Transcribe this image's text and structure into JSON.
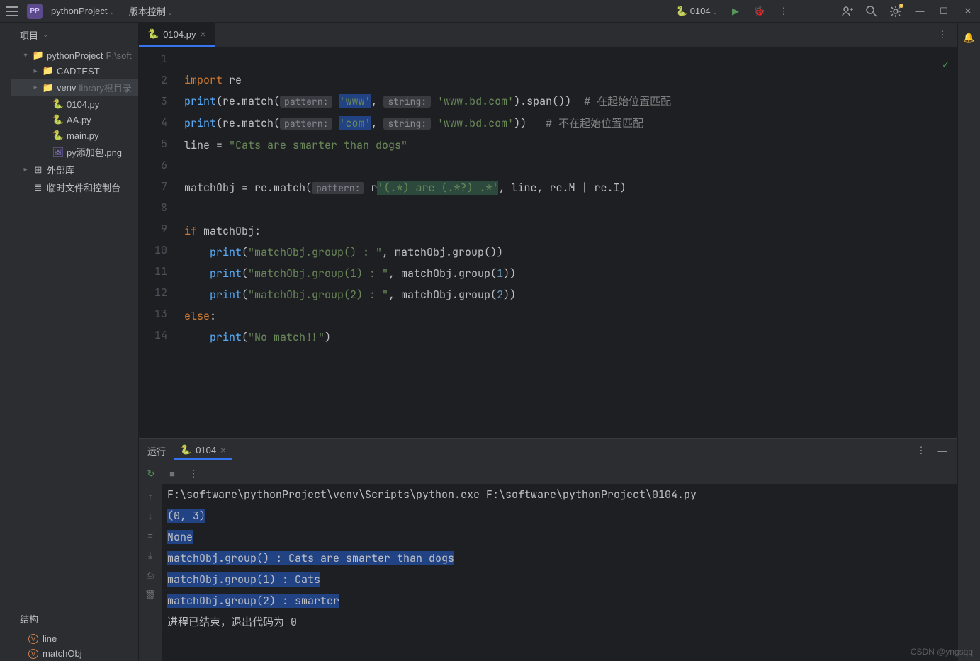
{
  "titlebar": {
    "project_badge": "PP",
    "project_name": "pythonProject",
    "vcs_label": "版本控制",
    "run_config": "0104",
    "icons": {
      "add_user": "👤₊",
      "search": "🔍",
      "settings": "⚙",
      "minimize": "—",
      "maximize": "☐",
      "close": "✕"
    }
  },
  "sidebar": {
    "header": "项目",
    "root": {
      "name": "pythonProject",
      "hint": "F:\\soft"
    },
    "items": [
      {
        "indent": 1,
        "arrow": "▾",
        "icon": "folder",
        "label": "pythonProject",
        "hint": "F:\\soft"
      },
      {
        "indent": 2,
        "arrow": "▸",
        "icon": "folder",
        "label": "CADTEST"
      },
      {
        "indent": 2,
        "arrow": "▸",
        "icon": "folder",
        "label": "venv",
        "hint": "library根目录",
        "sel": true
      },
      {
        "indent": 3,
        "arrow": "",
        "icon": "py",
        "label": "0104.py"
      },
      {
        "indent": 3,
        "arrow": "",
        "icon": "py",
        "label": "AA.py"
      },
      {
        "indent": 3,
        "arrow": "",
        "icon": "py",
        "label": "main.py"
      },
      {
        "indent": 3,
        "arrow": "",
        "icon": "img",
        "label": "py添加包.png"
      },
      {
        "indent": 1,
        "arrow": "▸",
        "icon": "lib",
        "label": "外部库"
      },
      {
        "indent": 1,
        "arrow": "",
        "icon": "scratch",
        "label": "临时文件和控制台"
      }
    ],
    "structure_header": "结构",
    "structure": [
      {
        "badge": "V",
        "label": "line"
      },
      {
        "badge": "V",
        "label": "matchObj"
      }
    ]
  },
  "editor": {
    "tab_name": "0104.py",
    "lines": [
      "1",
      "2",
      "3",
      "4",
      "5",
      "6",
      "7",
      "8",
      "9",
      "10",
      "11",
      "12",
      "13",
      "14"
    ],
    "code": {
      "l1_import": "import",
      "l1_re": " re",
      "l2_print": "print",
      "l2_match": "(re.match(",
      "l2_pat": "pattern:",
      "l2_www": "'www'",
      "l2_comma": ", ",
      "l2_str": "string:",
      "l2_strval": " 'www.bd.com'",
      "l2_span": ").span())",
      "l2_cmt": "  # 在起始位置匹配",
      "l3_print": "print",
      "l3_match": "(re.match(",
      "l3_pat": "pattern:",
      "l3_com": "'com'",
      "l3_comma": ", ",
      "l3_str": "string:",
      "l3_strval": " 'www.bd.com'",
      "l3_end": "))",
      "l3_cmt": "   # 不在起始位置匹配",
      "l4": "line = ",
      "l4_str": "\"Cats are smarter than dogs\"",
      "l6_a": "matchObj = re.match(",
      "l6_pat": "pattern:",
      "l6_r": " r",
      "l6_re": "'(.*) are (.*?) .*'",
      "l6_b": ", line, re.M | re.I)",
      "l8_if": "if",
      "l8_b": " matchObj:",
      "l9_p": "    print",
      "l9_s": "(",
      "l9_str": "\"matchObj.group() : \"",
      "l9_e": ", matchObj.group())",
      "l10_p": "    print",
      "l10_s": "(",
      "l10_str": "\"matchObj.group(1) : \"",
      "l10_e": ", matchObj.group(",
      "l10_n": "1",
      "l10_f": "))",
      "l11_p": "    print",
      "l11_s": "(",
      "l11_str": "\"matchObj.group(2) : \"",
      "l11_e": ", matchObj.group(",
      "l11_n": "2",
      "l11_f": "))",
      "l12_else": "else",
      "l12_c": ":",
      "l13_p": "    print",
      "l13_s": "(",
      "l13_str": "\"No match!!\"",
      "l13_e": ")"
    }
  },
  "run": {
    "label": "运行",
    "tab": "0104",
    "cmd": "F:\\software\\pythonProject\\venv\\Scripts\\python.exe F:\\software\\pythonProject\\0104.py",
    "out": [
      "(0, 3)",
      "None",
      "matchObj.group() :  Cats are smarter than dogs",
      "matchObj.group(1) :  Cats",
      "matchObj.group(2) :  smarter"
    ],
    "exit": "进程已结束，退出代码为 0"
  },
  "watermark": "CSDN @yngsqq"
}
